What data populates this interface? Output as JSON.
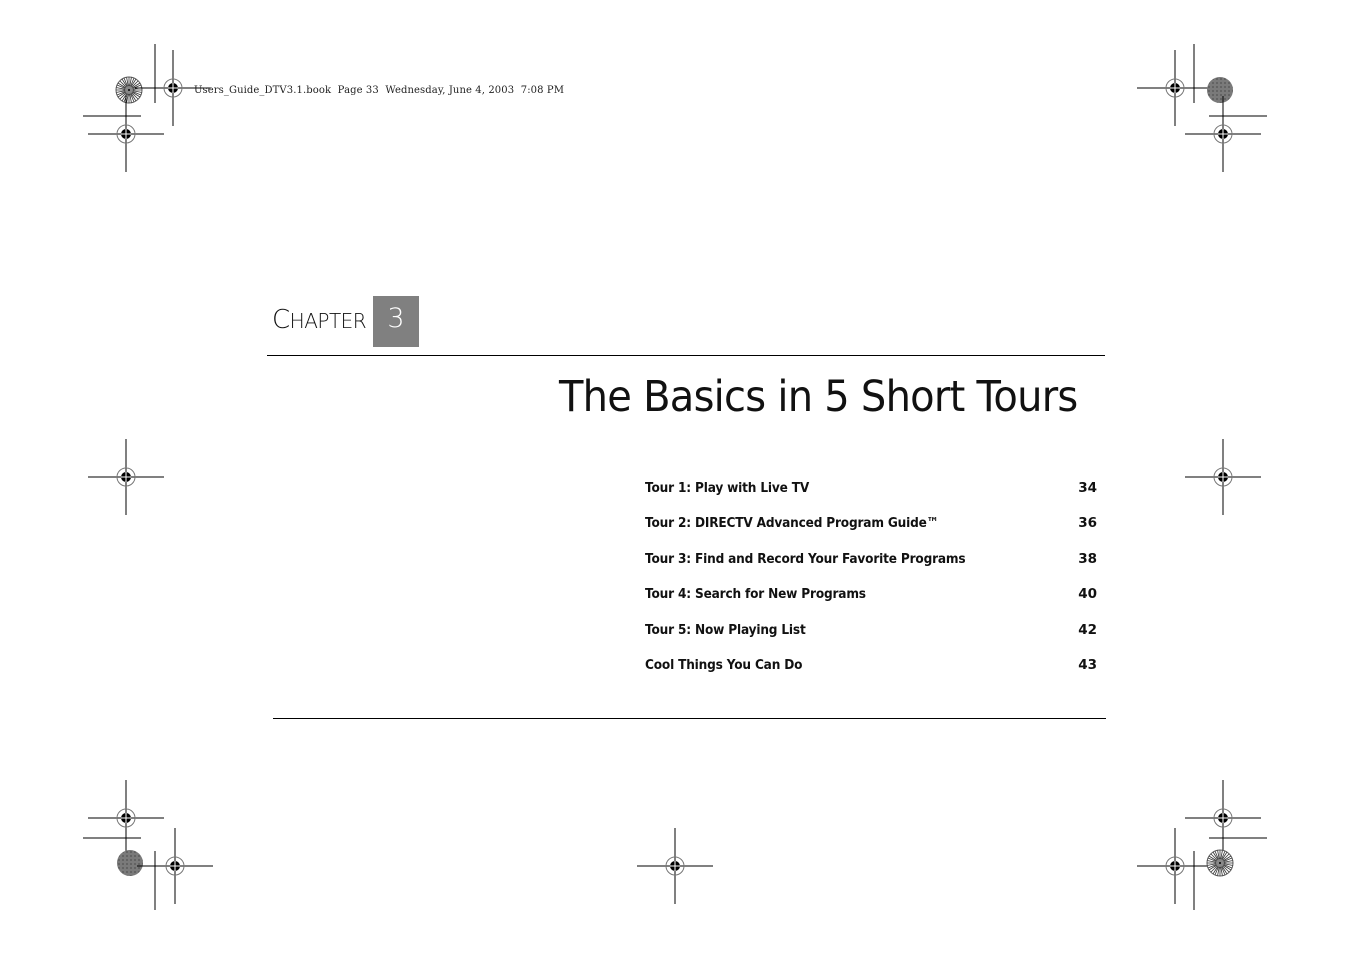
{
  "slug_line": "Users_Guide_DTV3.1.book  Page 33  Wednesday, June 4, 2003  7:08 PM",
  "chapter": {
    "label_first_letter": "C",
    "label_rest": "HAPTER",
    "number": "3",
    "number_box_color": "#808080"
  },
  "title": "The Basics in 5 Short Tours",
  "toc": [
    {
      "label": "Tour 1: Play with Live TV",
      "page": "34"
    },
    {
      "label": "Tour 2: DIRECTV Advanced Program Guide™",
      "page": "36"
    },
    {
      "label": "Tour 3: Find and Record Your Favorite Programs",
      "page": "38"
    },
    {
      "label": "Tour 4: Search for New Programs",
      "page": "40"
    },
    {
      "label": "Tour 5: Now Playing List",
      "page": "42"
    },
    {
      "label": "Cool Things You Can Do",
      "page": "43"
    }
  ],
  "icons": {
    "registration_mark": "registration-crosshair",
    "color_target_starburst": "starburst-target",
    "color_target_solid": "solid-gray-target"
  }
}
